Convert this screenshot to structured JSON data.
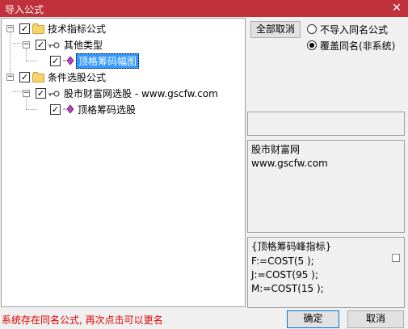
{
  "window": {
    "title": "导入公式",
    "close_glyph": "✕"
  },
  "tree": {
    "nodes": [
      {
        "label": "技术指标公式",
        "expander": "−",
        "checked": "✓",
        "icon": "folder-icon"
      },
      {
        "label": "其他类型",
        "expander": "−",
        "checked": "✓",
        "icon": "key-icon"
      },
      {
        "label": "顶格筹码幅图",
        "checked": "✓",
        "icon": "formula-icon",
        "selected": true
      },
      {
        "label": "条件选股公式",
        "expander": "−",
        "checked": "✓",
        "icon": "folder-icon"
      },
      {
        "label": "股市财富网选股 - www.gscfw.com",
        "expander": "−",
        "checked": "✓",
        "icon": "key-icon"
      },
      {
        "label": "顶格筹码选股",
        "checked": "✓",
        "icon": "formula-icon"
      }
    ]
  },
  "options": {
    "cancel_all_label": "全部取消",
    "radio_no_import": "不导入同名公式",
    "radio_overwrite": "覆盖同名(非系统)",
    "selected": "overwrite"
  },
  "info_panel": {
    "lines": [
      "股市财富网",
      "www.gscfw.com"
    ]
  },
  "formula_panel": {
    "lines": [
      "{顶格筹码峰指标}",
      "F:=COST(5 );",
      "J:=COST(95 );",
      "M:=COST(15 );"
    ]
  },
  "status": "系统存在同名公式, 再次点击可以更名",
  "buttons": {
    "ok": "确定",
    "cancel": "取消"
  },
  "colors": {
    "titlebar": "#c0313b",
    "status_text": "#e00000",
    "selection": "#3399ff"
  }
}
